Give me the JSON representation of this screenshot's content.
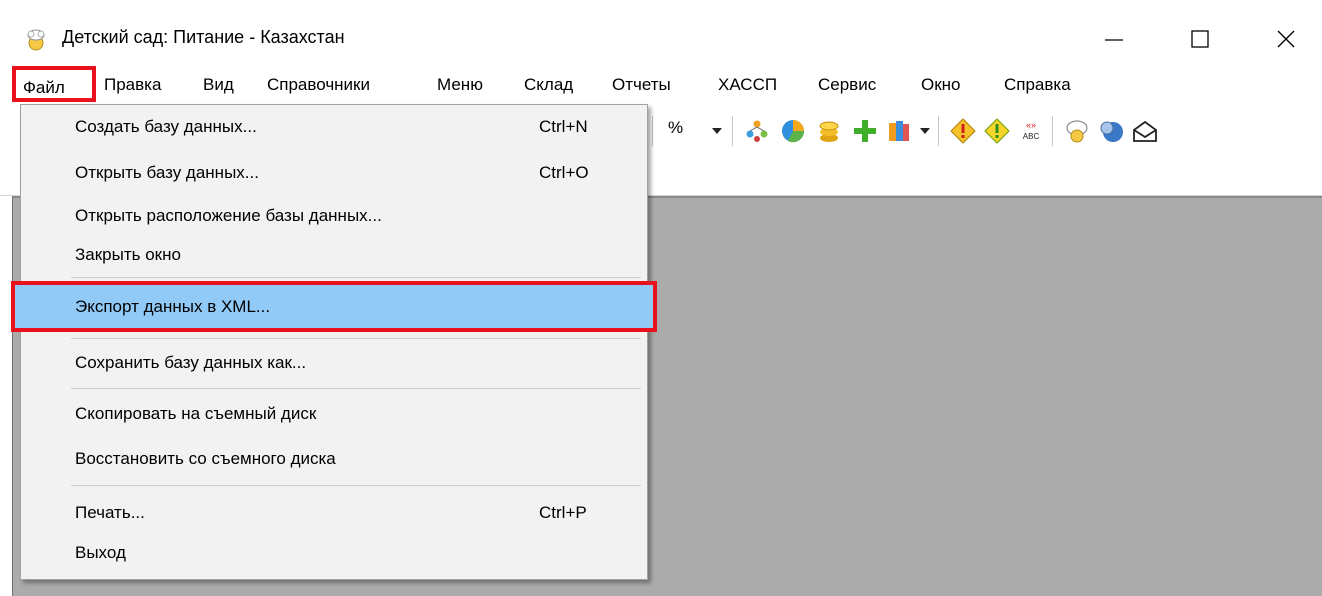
{
  "window": {
    "title": "Детский сад: Питание - Казахстан"
  },
  "menubar": {
    "items": [
      "Файл",
      "Правка",
      "Вид",
      "Справочники",
      "Меню",
      "Склад",
      "Отчеты",
      "ХАССП",
      "Сервис",
      "Окно",
      "Справка"
    ]
  },
  "toolbar": {
    "percent_label": "%",
    "icons": [
      "percent-dropdown",
      "tree-icon",
      "pie-chart-icon",
      "coins-icon",
      "green-plus-icon",
      "books-icon",
      "warning-diamond-icon",
      "warning-diamond-2-icon",
      "abc-quotes-icon",
      "chef-icon",
      "globe-icon",
      "envelope-icon"
    ]
  },
  "file_menu": {
    "items": [
      {
        "label": "Создать базу данных...",
        "shortcut": "Ctrl+N"
      },
      {
        "label": "Открыть базу данных...",
        "shortcut": "Ctrl+O"
      },
      {
        "label": "Открыть расположение базы данных...",
        "shortcut": ""
      },
      {
        "label": "Закрыть окно",
        "shortcut": ""
      },
      {
        "label": "Экспорт данных в XML...",
        "shortcut": ""
      },
      {
        "label": "Сохранить базу данных как...",
        "shortcut": ""
      },
      {
        "label": "Скопировать на съемный диск",
        "shortcut": ""
      },
      {
        "label": "Восстановить со съемного диска",
        "shortcut": ""
      },
      {
        "label": "Печать...",
        "shortcut": "Ctrl+P"
      },
      {
        "label": "Выход",
        "shortcut": ""
      }
    ],
    "highlighted_index": 4
  },
  "colors": {
    "highlight_fill": "#91c9f7",
    "annotation_red": "#e8121e",
    "workspace_gray": "#ababab"
  }
}
